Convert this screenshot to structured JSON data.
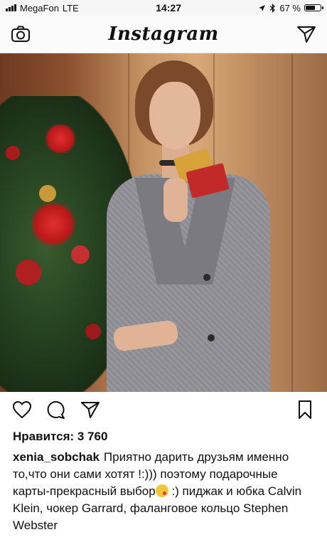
{
  "status_bar": {
    "carrier": "MegaFon",
    "network": "LTE",
    "time": "14:27",
    "battery": "67 %",
    "battery_level": 0.67
  },
  "nav": {
    "title": "Instagram"
  },
  "post": {
    "likes_text": "Нравится: 3 760",
    "username": "xenia_sobchak",
    "caption_part1": "Приятно дарить друзьям именно то,что они сами хотят !:))) поэтому подарочные карты-прекрасный выбор",
    "caption_part2": ":) пиджак и юбка Calvin Klein, чокер Garrard, фаланговое кольцо Stephen Webster"
  },
  "icons": {
    "camera": "camera-icon",
    "direct": "paper-plane-icon",
    "like": "heart-icon",
    "comment": "comment-icon",
    "share": "share-icon",
    "save": "bookmark-icon",
    "emoji": "kiss-emoji-icon"
  },
  "colors": {
    "text": "#111111",
    "background": "#ffffff"
  }
}
